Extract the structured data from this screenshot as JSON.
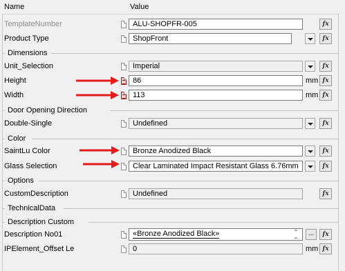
{
  "header": {
    "name_col": "Name",
    "value_col": "Value"
  },
  "colors": {
    "arrow": "#e31b1b",
    "readonly_bg": "#f0f0f0",
    "field_bg": "#ffffff"
  },
  "fx_label": "fx",
  "properties": {
    "template_number": {
      "label": "TemplateNumber",
      "value": "ALU-SHOPFR-005",
      "disabled": true
    },
    "product_type": {
      "label": "Product Type",
      "value": "ShopFront"
    },
    "unit_selection": {
      "label": "Unit_Selection",
      "value": "Imperial"
    },
    "height": {
      "label": "Height",
      "value": "86",
      "unit": "mm"
    },
    "width": {
      "label": "Width",
      "value": "113",
      "unit": "mm"
    },
    "double_single": {
      "label": "Double-Single",
      "value": "Undefined"
    },
    "saintlu_color": {
      "label": "SaintLu Color",
      "value": "Bronze Anodized Black"
    },
    "glass_selection": {
      "label": "Glass Selection",
      "value": "Clear Laminated Impact Resistant Glass 6.76mm"
    },
    "custom_description": {
      "label": "CustomDescription",
      "value": "Undefined"
    },
    "description_no01": {
      "label": "Description No01",
      "value": "«Bronze Anodized Black»",
      "spin_up": "⌃",
      "spin_down": "⌄",
      "ellipsis": "..."
    },
    "ipelement_offset": {
      "label": "IPElement_Offset Le",
      "value": "0",
      "unit": "mm"
    }
  },
  "sections": {
    "dimensions": "Dimensions",
    "door_opening": "Door Opening Direction",
    "color": "Color",
    "options": "Options",
    "technical_data": "TechnicalData",
    "description_custom": "Description Custom"
  }
}
